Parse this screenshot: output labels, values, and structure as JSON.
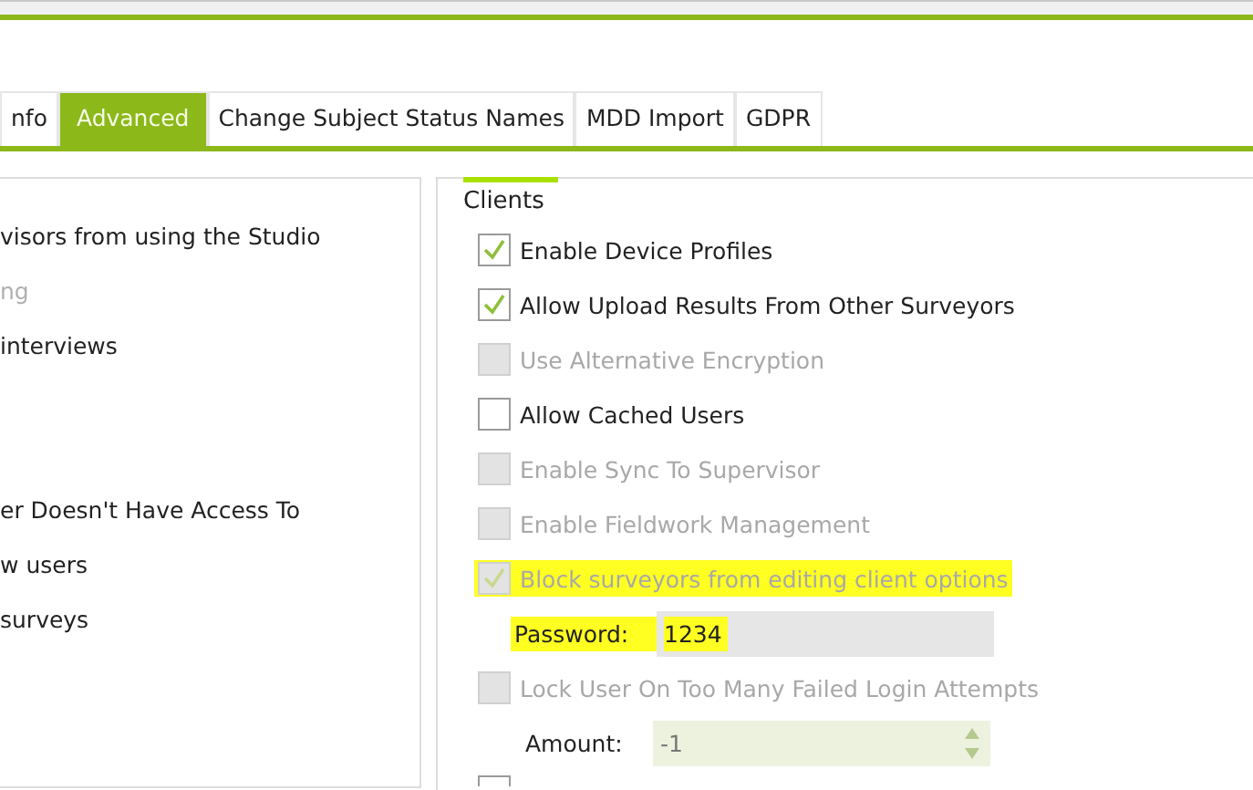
{
  "tabs": [
    {
      "label": "nfo",
      "selected": false
    },
    {
      "label": "Advanced",
      "selected": true
    },
    {
      "label": "Change Subject Status Names",
      "selected": false
    },
    {
      "label": "MDD Import",
      "selected": false
    },
    {
      "label": "GDPR",
      "selected": false
    }
  ],
  "left_panel": {
    "items": [
      {
        "text": "visors from using the Studio",
        "disabled": false
      },
      {
        "text": "ng",
        "disabled": true
      },
      {
        "text": "interviews",
        "disabled": false
      },
      {
        "text": "er Doesn't Have Access To",
        "disabled": false
      },
      {
        "text": "w users",
        "disabled": false
      },
      {
        "text": " surveys",
        "disabled": false
      }
    ]
  },
  "clients": {
    "title": "Clients",
    "options": [
      {
        "kind": "checkbox",
        "label": "Enable Device Profiles",
        "checked": true,
        "disabled": false,
        "highlighted": false
      },
      {
        "kind": "checkbox",
        "label": "Allow Upload Results From Other Surveyors",
        "checked": true,
        "disabled": false,
        "highlighted": false
      },
      {
        "kind": "checkbox",
        "label": "Use Alternative Encryption",
        "checked": false,
        "disabled": true,
        "highlighted": false
      },
      {
        "kind": "checkbox",
        "label": "Allow Cached Users",
        "checked": false,
        "disabled": false,
        "highlighted": false
      },
      {
        "kind": "checkbox",
        "label": "Enable Sync To Supervisor",
        "checked": false,
        "disabled": true,
        "highlighted": false
      },
      {
        "kind": "checkbox",
        "label": "Enable Fieldwork Management",
        "checked": false,
        "disabled": true,
        "highlighted": false
      },
      {
        "kind": "checkbox",
        "label": "Block surveyors from editing client options",
        "checked": true,
        "disabled": true,
        "highlighted": true
      },
      {
        "kind": "text",
        "label": "Password:",
        "value": "1234",
        "disabled": true,
        "highlighted": true
      },
      {
        "kind": "checkbox",
        "label": "Lock User On Too Many Failed Login Attempts",
        "checked": false,
        "disabled": true,
        "highlighted": false
      },
      {
        "kind": "spinner",
        "label": "Amount:",
        "value": "-1",
        "disabled": true,
        "highlighted": false
      },
      {
        "kind": "checkbox",
        "checked": false,
        "disabled": false,
        "highlighted": false
      }
    ]
  }
}
